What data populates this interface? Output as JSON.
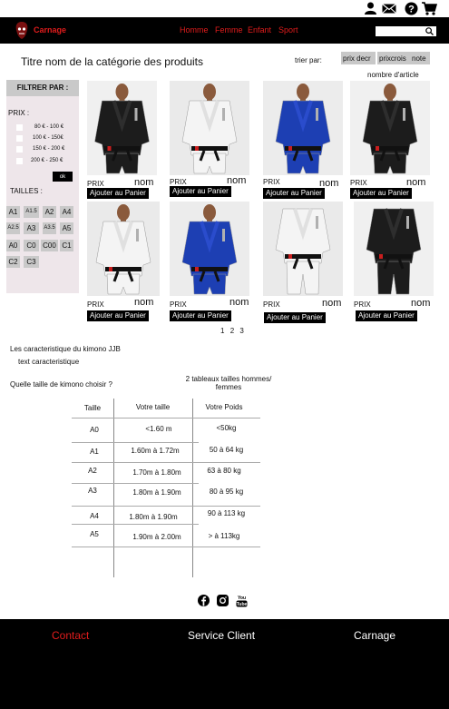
{
  "top_icons": [
    "account-icon",
    "mail-icon",
    "help-icon",
    "cart-icon"
  ],
  "nav": {
    "brand": "Carnage",
    "links": [
      "Homme",
      "Femme",
      "Enfant",
      "Sport"
    ],
    "search_placeholder": ""
  },
  "category": {
    "title": "Titre nom de la catégorie des produits",
    "sort_label": "trier par:",
    "sort_options": [
      "prix decr",
      "prixcrois",
      "note"
    ],
    "count_label": "nombre d'article"
  },
  "filter": {
    "heading": "FILTRER PAR :",
    "price_label": "PRIX :",
    "price_ranges": [
      "80 € - 100 €",
      "100 € - 150€",
      "150 € - 200 €",
      "200 € - 250 €"
    ],
    "ok_label": "ok",
    "sizes_label": "TAILLES :",
    "sizes": [
      "A1",
      "A1.5",
      "A2",
      "A4",
      "A2.5",
      "A3",
      "A3.5",
      "A5",
      "A0",
      "C0",
      "C00",
      "C1",
      "C2",
      "C3"
    ]
  },
  "products": [
    {
      "prix": "PRIX",
      "nom": "nom",
      "cart": "Ajouter au Panier",
      "kimono": "black"
    },
    {
      "prix": "PRIX",
      "nom": "nom",
      "cart": "Ajouter au Panier",
      "kimono": "white"
    },
    {
      "prix": "PRIX",
      "nom": "nom",
      "cart": "Ajouter au Panier",
      "kimono": "blue"
    },
    {
      "prix": "PRIX",
      "nom": "nom",
      "cart": "Ajouter au Panier",
      "kimono": "black"
    },
    {
      "prix": "PRIX",
      "nom": "nom",
      "cart": "Ajouter au Panier",
      "kimono": "white"
    },
    {
      "prix": "PRIX",
      "nom": "nom",
      "cart": "Ajouter au Panier",
      "kimono": "blue"
    },
    {
      "prix": "PRIX",
      "nom": "nom",
      "cart": "Ajouter au Panier",
      "kimono": "white"
    },
    {
      "prix": "PRIX",
      "nom": "nom",
      "cart": "Ajouter au Panier",
      "kimono": "black"
    }
  ],
  "pagination": [
    "1",
    "2",
    "3"
  ],
  "characteristics": {
    "title": "Les caracteristique du kimono JJB",
    "text": "text caracteristique",
    "size_question": "Quelle taille de kimono choisir ?",
    "tables_note": "2 tableaux tailles hommes/ femmes"
  },
  "size_table": {
    "headers": [
      "Taille",
      "Votre taille",
      "Votre Poids"
    ],
    "rows": [
      [
        "A0",
        "<1.60 m",
        "<50kg"
      ],
      [
        "A1",
        "1.60m à 1.72m",
        "50 à 64 kg"
      ],
      [
        "A2",
        "1.70m à 1.80m",
        "63 à 80 kg"
      ],
      [
        "A3",
        "1.80m à 1.90m",
        "80 à 95 kg"
      ],
      [
        "A4",
        "1.80m à 1.90m",
        "90 à 113 kg"
      ],
      [
        "A5",
        "1.90m à 2.00m",
        "> à 113kg"
      ]
    ]
  },
  "social": [
    "facebook-icon",
    "instagram-icon",
    "youtube-icon"
  ],
  "footer": {
    "contact": "Contact",
    "service": "Service Client",
    "brand": "Carnage"
  },
  "colors": {
    "accent": "#e21c1c",
    "nav_bg": "#000000",
    "panel_bg": "#eee6ea",
    "chip_bg": "#c9c9c9"
  }
}
